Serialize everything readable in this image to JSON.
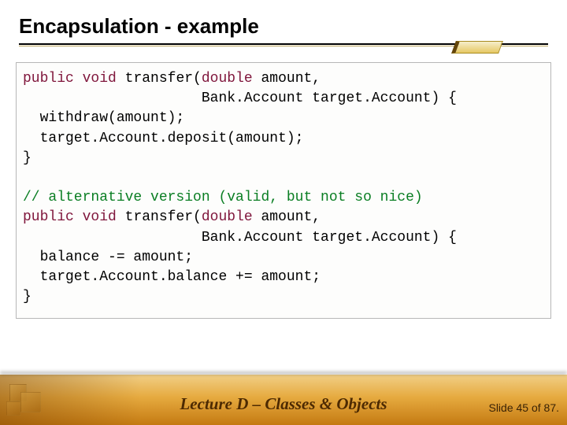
{
  "title": "Encapsulation - example",
  "code": {
    "m1_line1_a": "public",
    "m1_line1_b": " ",
    "m1_line1_c": "void",
    "m1_line1_d": " transfer(",
    "m1_line1_e": "double",
    "m1_line1_f": " amount,",
    "m1_line2": "                     Bank.Account target.Account) {",
    "m1_line3": "  withdraw(amount);",
    "m1_line4": "  target.Account.deposit(amount);",
    "m1_line5": "}",
    "blank": "",
    "comment": "// alternative version (valid, but not so nice)",
    "m2_line1_a": "public",
    "m2_line1_b": " ",
    "m2_line1_c": "void",
    "m2_line1_d": " transfer(",
    "m2_line1_e": "double",
    "m2_line1_f": " amount,",
    "m2_line2": "                     Bank.Account target.Account) {",
    "m2_line3": "  balance -= amount;",
    "m2_line4": "  target.Account.balance += amount;",
    "m2_line5": "}"
  },
  "footer": {
    "lecture": "Lecture D – Classes & Objects",
    "slide_info": "Slide 45 of 87."
  }
}
